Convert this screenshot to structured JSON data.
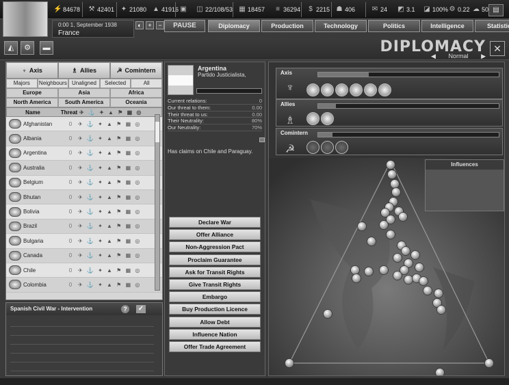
{
  "topbar": {
    "resources": [
      {
        "icon": "energy-icon",
        "glyph": "⚡",
        "value": "84678"
      },
      {
        "icon": "metal-icon",
        "glyph": "⚒",
        "value": "42401"
      },
      {
        "icon": "rare-materials-icon",
        "glyph": "✦",
        "value": "21080"
      },
      {
        "icon": "oil-icon",
        "glyph": "▲",
        "value": "41916"
      },
      {
        "icon": "supplies-icon",
        "glyph": "▣",
        "value": ""
      },
      {
        "icon": "manpower-icon",
        "glyph": "◫",
        "value": "22/108/53"
      },
      {
        "icon": "money-icon",
        "glyph": "▦",
        "value": "18457"
      },
      {
        "icon": "transport-icon",
        "glyph": "≡",
        "value": "36294"
      },
      {
        "icon": "dissent-icon",
        "glyph": "$",
        "value": "2215"
      },
      {
        "icon": "officers-icon",
        "glyph": "☗",
        "value": "406"
      },
      {
        "icon": "messages-icon",
        "glyph": "✉",
        "value": "24"
      },
      {
        "icon": "score-icon",
        "glyph": "◩",
        "value": "3.1"
      },
      {
        "icon": "efficiency-icon",
        "glyph": "◪",
        "value": "100%"
      },
      {
        "icon": "ic-icon",
        "glyph": "⚙",
        "value": "0.22"
      },
      {
        "icon": "national-unity-icon",
        "glyph": "☁",
        "value": "50%"
      }
    ],
    "menu_label": "▤"
  },
  "date": {
    "text": "0:00 1, September 1938",
    "country": "France"
  },
  "speed_buttons": [
    "◐",
    "+",
    "−"
  ],
  "pause_label": "PAUSE",
  "tabs": [
    {
      "label": "Diplomacy",
      "active": true
    },
    {
      "label": "Production",
      "active": false
    },
    {
      "label": "Technology",
      "active": false
    },
    {
      "label": "Politics",
      "active": false
    },
    {
      "label": "Intelligence",
      "active": false
    },
    {
      "label": "Statistics",
      "active": false
    }
  ],
  "header": {
    "icons": [
      "◭",
      "⚙",
      "▬"
    ],
    "title": "DIPLOMACY",
    "mode_prev": "◀",
    "mode": "Normal",
    "mode_next": "▶",
    "close": "✕"
  },
  "factions": {
    "tabs": [
      {
        "symbol": "♆",
        "label": "Axis"
      },
      {
        "symbol": "♗",
        "label": "Allies"
      },
      {
        "symbol": "☭",
        "label": "Comintern"
      }
    ],
    "filters": [
      "Majors",
      "Neighbours",
      "Unaligned",
      "Selected",
      "All"
    ],
    "regions_row1": [
      "Europe",
      "Asia",
      "Africa"
    ],
    "regions_row2": [
      "North America",
      "South America",
      "Oceania"
    ]
  },
  "country_list": {
    "headers": {
      "name": "Name",
      "threat": "Threat",
      "icons": "✈ ⚓ ✦ ▲ ⚑ ▦ ◎"
    },
    "rows": [
      {
        "name": "Afghanistan",
        "threat": "0",
        "icons": "✈ ⚓ ✦ ▲ ⚑ ▦ ◎"
      },
      {
        "name": "Albania",
        "threat": "0",
        "icons": "✈ ⚓ ✦ ▲ ⚑ ▦ ◎"
      },
      {
        "name": "Argentina",
        "threat": "0",
        "icons": "✈ ⚓ ✦ ▲ ⚑ ▦ ◎"
      },
      {
        "name": "Australia",
        "threat": "0",
        "icons": "✈ ⚓ ✦ ▲ ⚑ ▦ ◎"
      },
      {
        "name": "Belgium",
        "threat": "0",
        "icons": "✈ ⚓ ✦ ▲ ⚑ ▦ ◎"
      },
      {
        "name": "Bhutan",
        "threat": "0",
        "icons": "✈ ⚓ ✦ ▲ ⚑ ▦ ◎"
      },
      {
        "name": "Bolivia",
        "threat": "0",
        "icons": "✈ ⚓ ✦ ▲ ⚑ ▦ ◎"
      },
      {
        "name": "Brazil",
        "threat": "0",
        "icons": "✈ ⚓ ✦ ▲ ⚑ ▦ ◎"
      },
      {
        "name": "Bulgaria",
        "threat": "0",
        "icons": "✈ ⚓ ✦ ▲ ⚑ ▦ ◎"
      },
      {
        "name": "Canada",
        "threat": "0",
        "icons": "✈ ⚓ ✦ ▲ ⚑ ▦ ◎"
      },
      {
        "name": "Chile",
        "threat": "0",
        "icons": "✈ ⚓ ✦ ▲ ⚑ ▦ ◎"
      },
      {
        "name": "Colombia",
        "threat": "0",
        "icons": "✈ ⚓ ✦ ▲ ⚑ ▦ ◎"
      }
    ]
  },
  "spanish_war": {
    "title": "Spanish Civil War - Intervention",
    "help": "?",
    "check": "✓"
  },
  "selected_country": {
    "name": "Argentina",
    "party": "Partido Justicialista,",
    "relations": [
      {
        "label": "Current relations:",
        "value": "0"
      },
      {
        "label": "Our threat to them:",
        "value": "0.00"
      },
      {
        "label": "Their threat to us:",
        "value": "0.00"
      },
      {
        "label": "Their Neutrality:",
        "value": "80%"
      },
      {
        "label": "Our Neutrality:",
        "value": "70%"
      }
    ],
    "claims": "Has claims on Chile and Paraguay."
  },
  "actions": [
    "Declare War",
    "Offer Alliance",
    "Non-Aggression Pact",
    "Proclaim Guarantee",
    "Ask for Transit Rights",
    "Give Transit Rights",
    "Embargo",
    "Buy Production Licence",
    "Allow Debt",
    "Influence Nation",
    "Offer Trade Agreement"
  ],
  "faction_boxes": [
    {
      "label": "Axis",
      "symbol": "♆",
      "members": 6,
      "dim": 0
    },
    {
      "label": "Allies",
      "symbol": "♗",
      "members": 2,
      "dim": 0
    },
    {
      "label": "Comintern",
      "symbol": "☭",
      "members": 3,
      "dim": 3
    }
  ],
  "influences_label": "Influences"
}
